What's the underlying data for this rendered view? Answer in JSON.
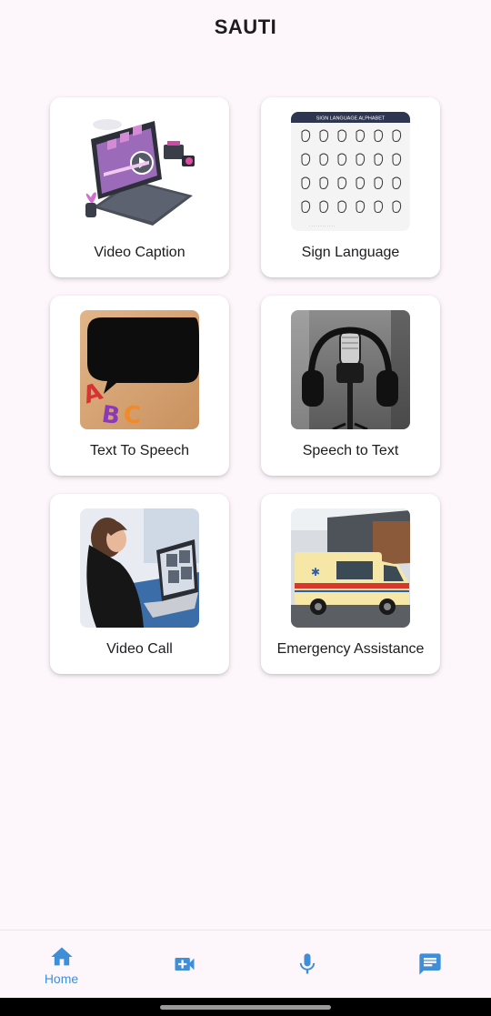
{
  "app": {
    "title": "SAUTI"
  },
  "features": [
    {
      "label": "Video Caption",
      "icon": "video-caption-illustration"
    },
    {
      "label": "Sign Language",
      "icon": "sign-language-chart",
      "image_header": "SIGN LANGUAGE ALPHABET"
    },
    {
      "label": "Text To Speech",
      "icon": "speech-bubble-abc",
      "image_letters": [
        "A",
        "B",
        "C"
      ]
    },
    {
      "label": "Speech to Text",
      "icon": "headphones-microphone"
    },
    {
      "label": "Video Call",
      "icon": "laptop-video-call"
    },
    {
      "label": "Emergency Assistance",
      "icon": "ambulance"
    }
  ],
  "bottom_nav": {
    "items": [
      {
        "label": "Home",
        "icon": "home-icon",
        "active": true
      },
      {
        "label": "",
        "icon": "video-call-add-icon",
        "active": false
      },
      {
        "label": "",
        "icon": "microphone-icon",
        "active": false
      },
      {
        "label": "",
        "icon": "chat-message-icon",
        "active": false
      }
    ]
  },
  "colors": {
    "background": "#fdf7fb",
    "card": "#ffffff",
    "accent": "#3f8fd8",
    "text": "#1d1b1f"
  }
}
